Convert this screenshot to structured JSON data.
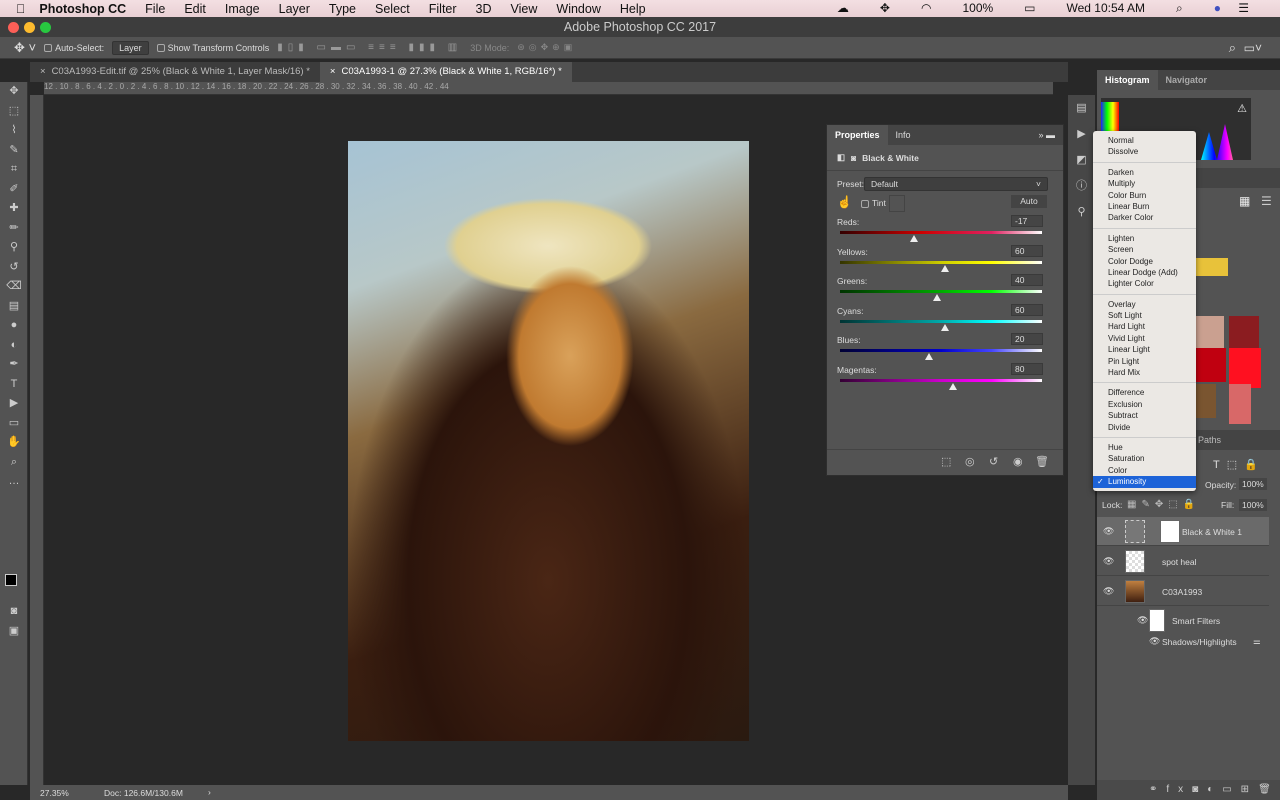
{
  "menubar": {
    "app": "Photoshop CC",
    "items": [
      "File",
      "Edit",
      "Image",
      "Layer",
      "Type",
      "Select",
      "Filter",
      "3D",
      "View",
      "Window",
      "Help"
    ],
    "battery": "100%",
    "clock": "Wed 10:54 AM"
  },
  "window": {
    "title": "Adobe Photoshop CC 2017"
  },
  "options": {
    "auto_select": "Auto-Select:",
    "auto_select_target": "Layer",
    "show_transform": "Show Transform Controls",
    "mode_3d": "3D Mode:"
  },
  "tabs": [
    {
      "label": "C03A1993-Edit.tif @ 25% (Black & White 1, Layer Mask/16) *",
      "active": false
    },
    {
      "label": "C03A1993-1 @ 27.3% (Black & White 1, RGB/16*) *",
      "active": true
    }
  ],
  "ruler": "12 . 10 . 8 . 6 . 4 . 2 . 0 . 2 . 4 . 6 . 8 . 10 . 12 . 14 . 16 . 18 . 20 . 22 . 24 . 26 . 28 . 30 . 32 . 34 . 36 . 38 . 40 . 42 . 44",
  "properties": {
    "tabs": [
      "Properties",
      "Info"
    ],
    "title": "Black & White",
    "preset_label": "Preset:",
    "preset": "Default",
    "tint": "Tint",
    "auto": "Auto",
    "sliders": [
      {
        "label": "Reds:",
        "value": "-17",
        "n": -17,
        "gradient": "linear-gradient(90deg,#300,#c00 40%,#e02060 75%,#fff)"
      },
      {
        "label": "Yellows:",
        "value": "60",
        "n": 60,
        "gradient": "linear-gradient(90deg,#330,#cc0 50%,#ff0 75%,#fff)"
      },
      {
        "label": "Greens:",
        "value": "40",
        "n": 40,
        "gradient": "linear-gradient(90deg,#030,#0a0 50%,#0f0 75%,#fff)"
      },
      {
        "label": "Cyans:",
        "value": "60",
        "n": 60,
        "gradient": "linear-gradient(90deg,#033,#0aa 50%,#0ff 75%,#fff)"
      },
      {
        "label": "Blues:",
        "value": "20",
        "n": 20,
        "gradient": "linear-gradient(90deg,#003,#00c 50%,#44f 75%,#fff)"
      },
      {
        "label": "Magentas:",
        "value": "80",
        "n": 80,
        "gradient": "linear-gradient(90deg,#303,#c0c 50%,#f0f 75%,#fff)"
      }
    ],
    "slider_range": [
      -200,
      300
    ]
  },
  "right": {
    "tabs": [
      "Histogram",
      "Navigator"
    ],
    "paths_tab": "Paths",
    "opacity_label": "Opacity:",
    "opacity": "100%",
    "lock_label": "Lock:",
    "fill_label": "Fill:",
    "fill": "100%",
    "layers": [
      {
        "name": "Black & White 1"
      },
      {
        "name": "spot heal"
      },
      {
        "name": "C03A1993"
      },
      {
        "name": "Smart Filters"
      },
      {
        "name": "Shadows/Highlights"
      }
    ],
    "swatches": [
      "#e8c23a",
      "#caa090",
      "#8b1c20",
      "#c00010",
      "#ff1020",
      "#7a5530",
      "#d86868"
    ]
  },
  "blend_menu": {
    "groups": [
      [
        "Normal",
        "Dissolve"
      ],
      [
        "Darken",
        "Multiply",
        "Color Burn",
        "Linear Burn",
        "Darker Color"
      ],
      [
        "Lighten",
        "Screen",
        "Color Dodge",
        "Linear Dodge (Add)",
        "Lighter Color"
      ],
      [
        "Overlay",
        "Soft Light",
        "Hard Light",
        "Vivid Light",
        "Linear Light",
        "Pin Light",
        "Hard Mix"
      ],
      [
        "Difference",
        "Exclusion",
        "Subtract",
        "Divide"
      ],
      [
        "Hue",
        "Saturation",
        "Color",
        "Luminosity"
      ]
    ],
    "selected": "Luminosity"
  },
  "status": {
    "zoom": "27.35%",
    "doc": "Doc: 126.6M/130.6M"
  }
}
